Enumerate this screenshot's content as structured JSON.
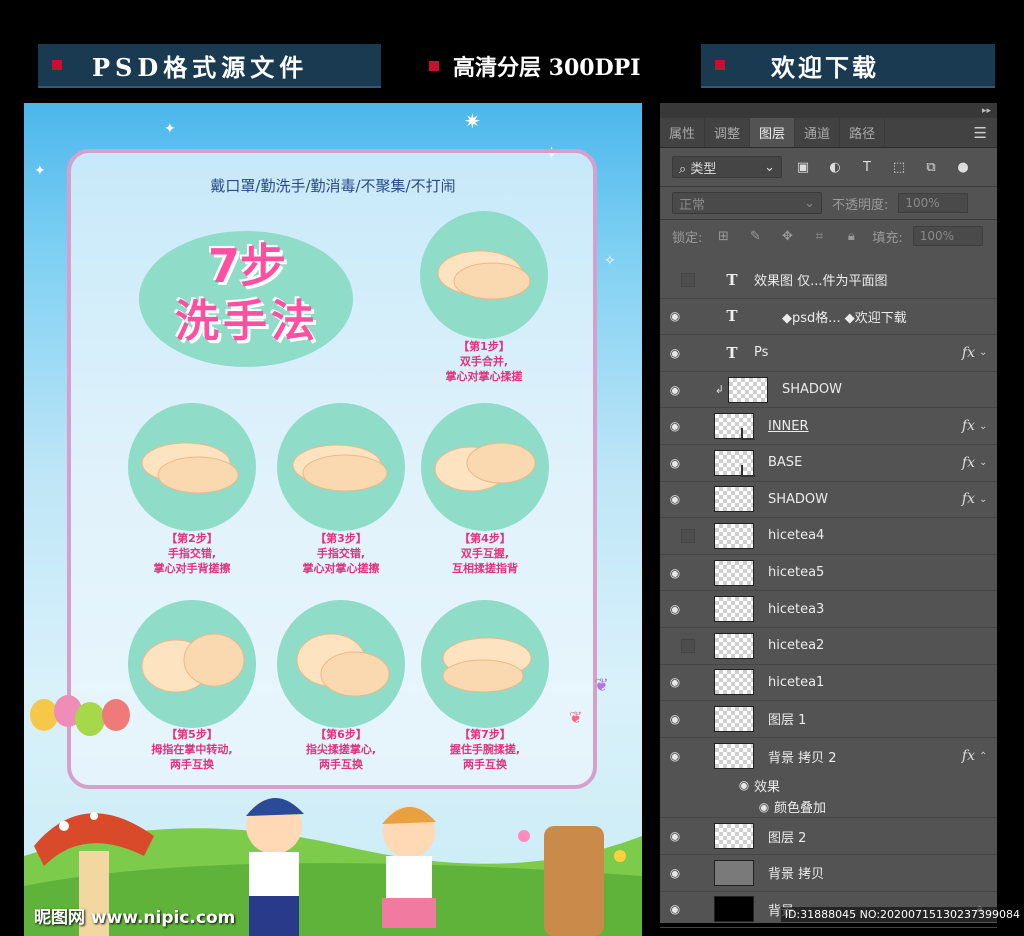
{
  "banner": {
    "left": "PSD格式源文件",
    "middle": "高清分层 300DPI",
    "right": "欢迎下载"
  },
  "poster": {
    "slogan": "戴口罩/勤洗手/勤消毒/不聚集/不打闹",
    "title_line1": "7步",
    "title_line2": "洗手法",
    "steps": [
      {
        "label": "【第1步】",
        "line1": "双手合并,",
        "line2": "掌心对掌心揉搓"
      },
      {
        "label": "【第2步】",
        "line1": "手指交错,",
        "line2": "掌心对手背搓擦"
      },
      {
        "label": "【第3步】",
        "line1": "手指交错,",
        "line2": "掌心对掌心搓擦"
      },
      {
        "label": "【第4步】",
        "line1": "双手互握,",
        "line2": "互相揉搓指背"
      },
      {
        "label": "【第5步】",
        "line1": "拇指在掌中转动,",
        "line2": "两手互换"
      },
      {
        "label": "【第6步】",
        "line1": "指尖揉搓掌心,",
        "line2": "两手互换"
      },
      {
        "label": "【第7步】",
        "line1": "握住手腕揉搓,",
        "line2": "两手互换"
      }
    ],
    "logo_text": "昵图网 www.nipic.com"
  },
  "panel": {
    "tabs": [
      "属性",
      "调整",
      "图层",
      "通道",
      "路径"
    ],
    "active_tab": "图层",
    "filter_label": "类型",
    "blend_mode": "正常",
    "opacity_label": "不透明度:",
    "opacity_value": "100%",
    "lock_label": "锁定:",
    "fill_label": "填充:",
    "fill_value": "100%",
    "layers": [
      {
        "name": "效果图 仅...件为平面图",
        "type": "text",
        "visible": false
      },
      {
        "name": "◆psd格... ◆欢迎下载",
        "type": "text",
        "visible": true
      },
      {
        "name": "Ps",
        "type": "text",
        "visible": true,
        "fx": "fx"
      },
      {
        "name": "SHADOW",
        "type": "clip",
        "visible": true
      },
      {
        "name": "INNER",
        "type": "mask",
        "visible": true,
        "fx": "fx"
      },
      {
        "name": "BASE",
        "type": "mask",
        "visible": true,
        "fx": "fx"
      },
      {
        "name": "SHADOW",
        "type": "raster",
        "visible": true,
        "fx": "fx"
      },
      {
        "name": "hicetea4",
        "type": "raster",
        "visible": false
      },
      {
        "name": "hicetea5",
        "type": "raster",
        "visible": true
      },
      {
        "name": "hicetea3",
        "type": "raster",
        "visible": true
      },
      {
        "name": "hicetea2",
        "type": "raster",
        "visible": false
      },
      {
        "name": "hicetea1",
        "type": "raster",
        "visible": true
      },
      {
        "name": "图层 1",
        "type": "raster",
        "visible": true
      },
      {
        "name": "背景 拷贝 2",
        "type": "raster",
        "visible": true,
        "fx": "fx"
      },
      {
        "name": "图层 2",
        "type": "raster",
        "visible": true
      },
      {
        "name": "背景 拷贝",
        "type": "gray",
        "visible": true
      },
      {
        "name": "背景",
        "type": "black",
        "visible": true
      }
    ],
    "effects_label": "效果",
    "color_overlay_label": "颜色叠加"
  },
  "watermark": "ID:31888045 NO:20200715130237399084"
}
